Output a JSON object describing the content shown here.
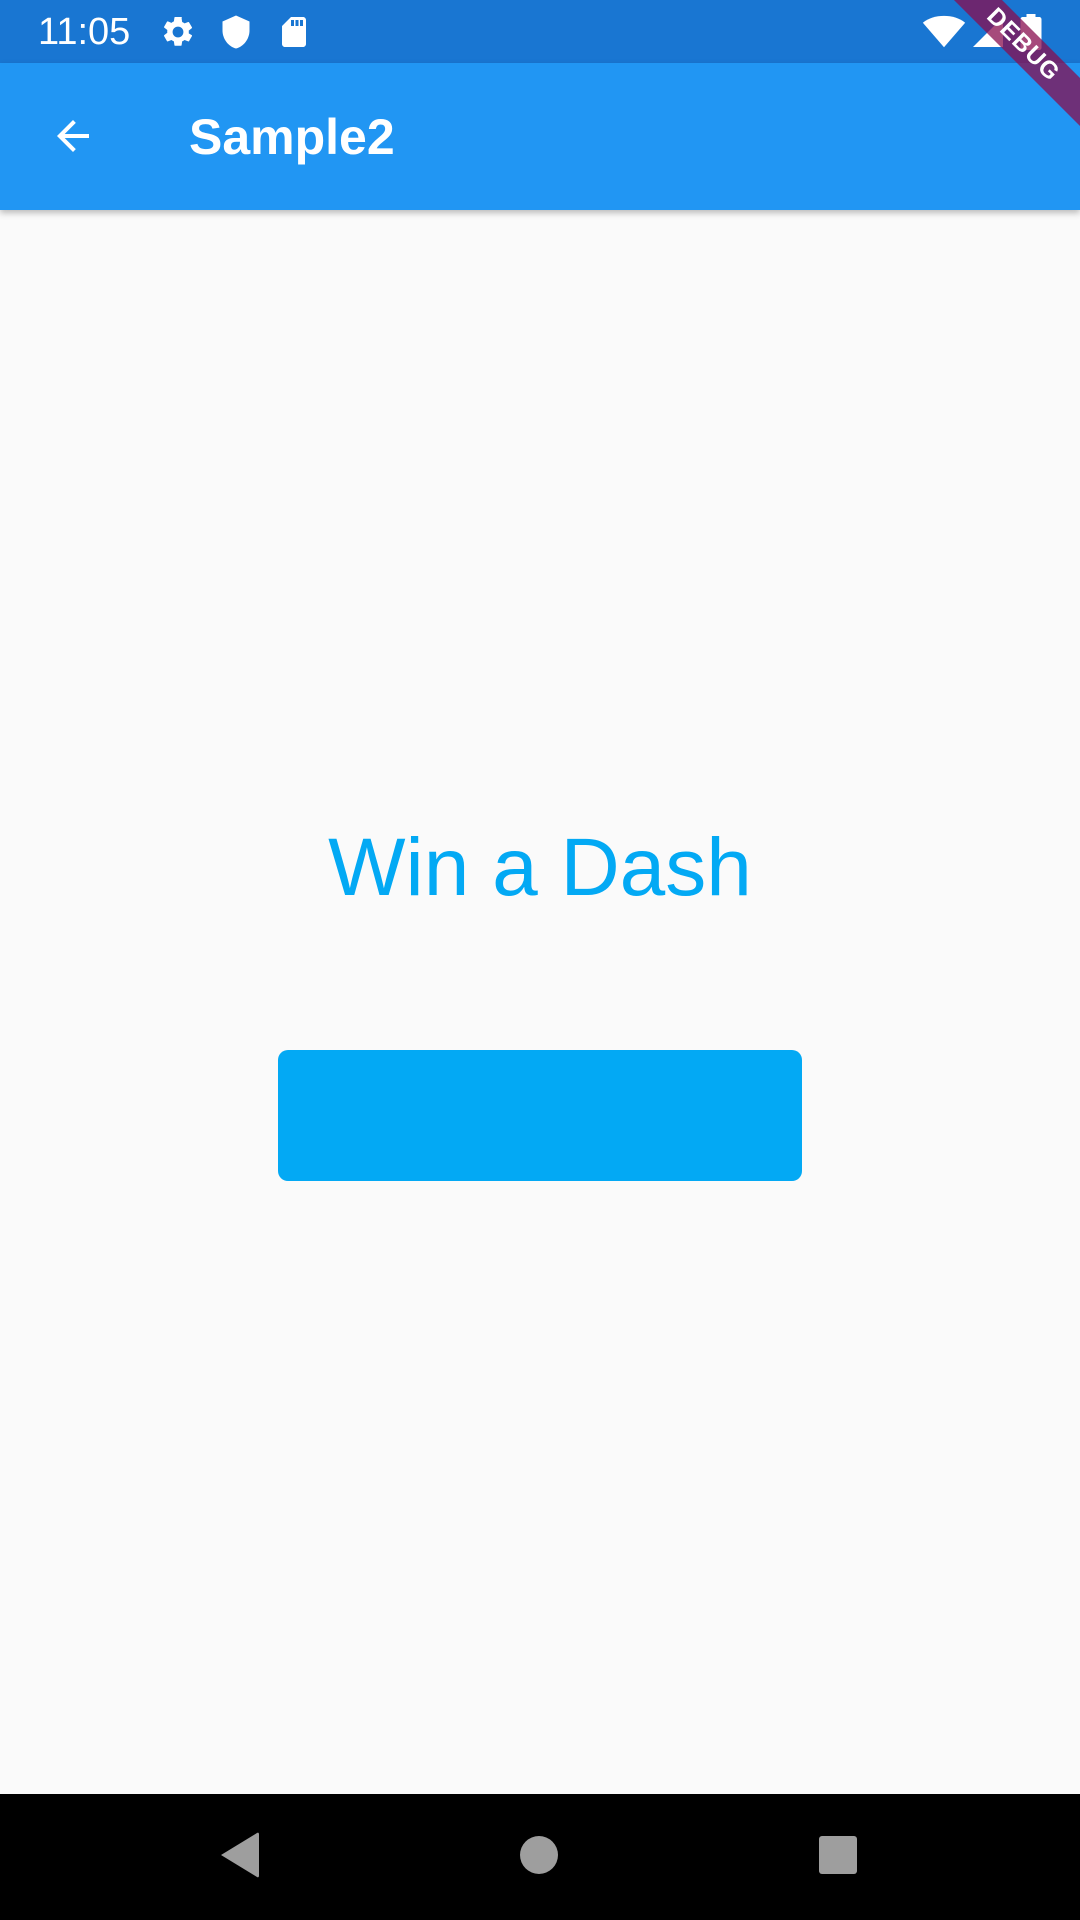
{
  "status_bar": {
    "time": "11:05",
    "left_icons": [
      "settings-icon",
      "shield-icon",
      "sd-card-icon"
    ],
    "right_icons": [
      "wifi-icon",
      "cell-signal-icon",
      "battery-icon"
    ]
  },
  "app_bar": {
    "back_icon": "arrow-back-icon",
    "title": "Sample2",
    "background": "#2196f3"
  },
  "debug_banner": {
    "label": "DEBUG"
  },
  "main": {
    "headline": "Win a Dash",
    "button_label": "",
    "accent": "#03a9f4"
  },
  "nav_bar": {
    "buttons": [
      "back-triangle-icon",
      "home-circle-icon",
      "recents-square-icon"
    ]
  }
}
